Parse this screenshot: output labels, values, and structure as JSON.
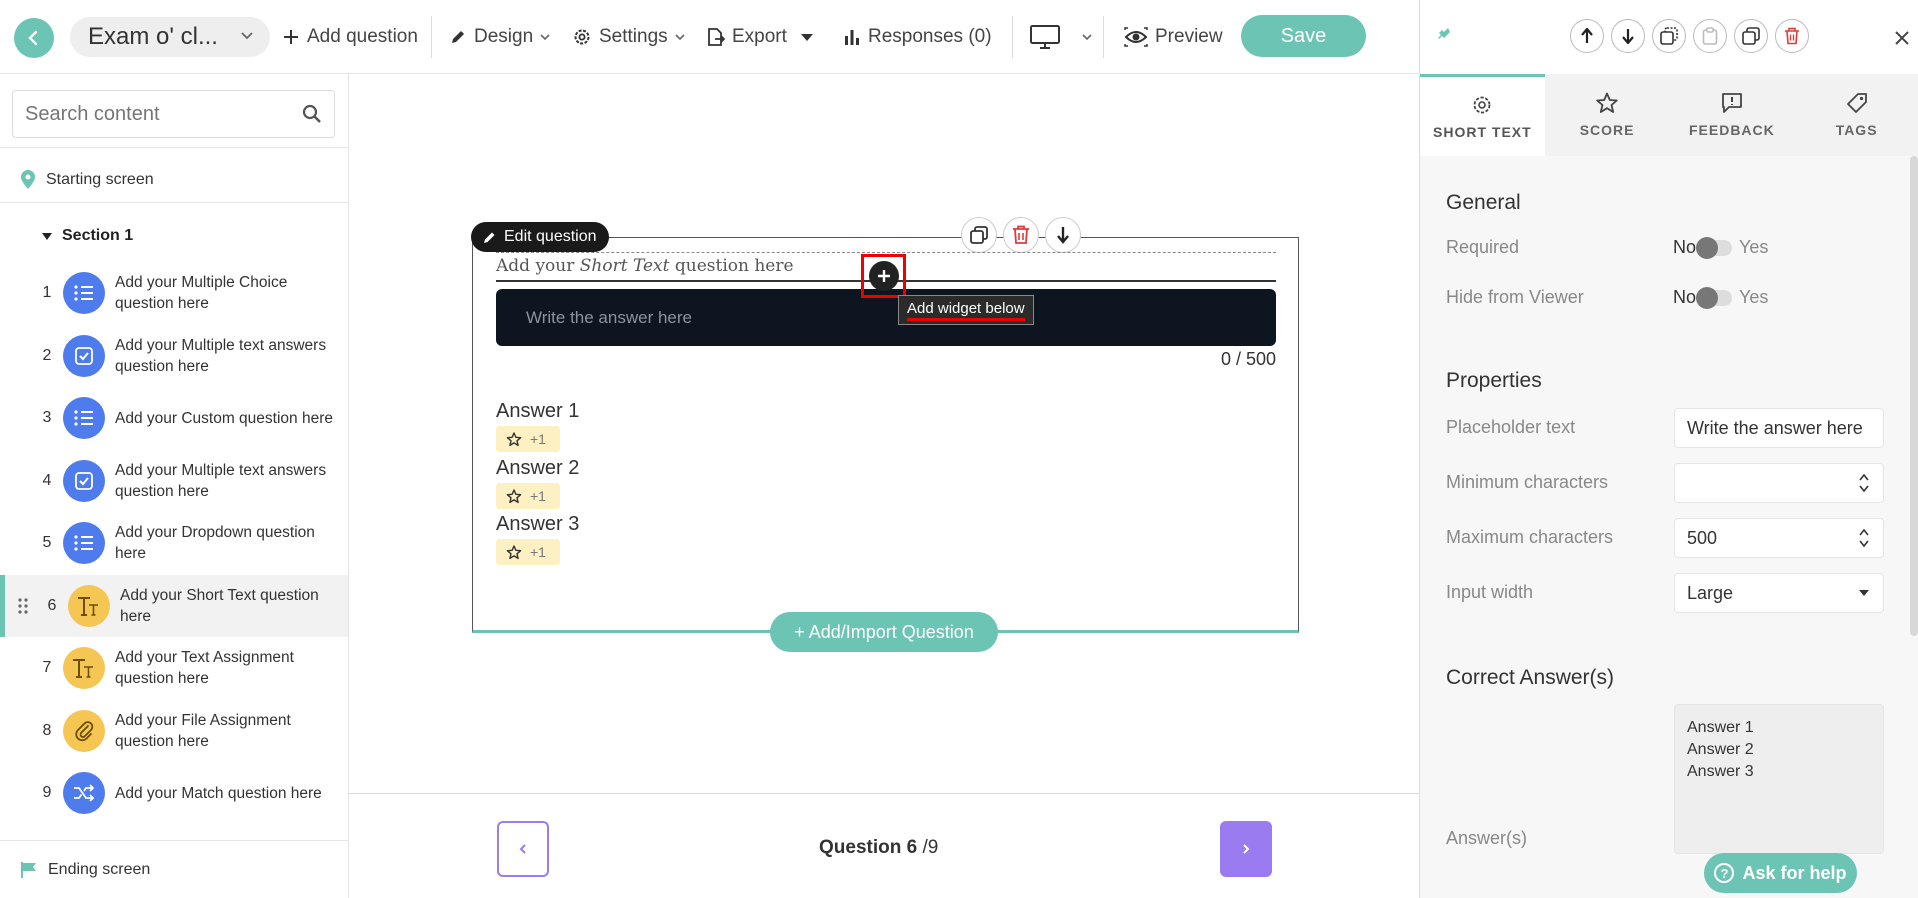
{
  "topbar": {
    "title": "Exam o' cl...",
    "add_question": "Add question",
    "design": "Design",
    "settings": "Settings",
    "export": "Export",
    "responses": "Responses (0)",
    "preview": "Preview",
    "save": "Save"
  },
  "sidebar": {
    "search_placeholder": "Search content",
    "starting_screen": "Starting screen",
    "section": "Section 1",
    "items": [
      {
        "num": "1",
        "label": "Add your Multiple Choice question here",
        "icon": "list-icon",
        "color": "#4f7cec"
      },
      {
        "num": "2",
        "label": "Add your Multiple text answers question here",
        "icon": "checkbox-icon",
        "color": "#4f7cec"
      },
      {
        "num": "3",
        "label": "Add your Custom question here",
        "icon": "list-icon",
        "color": "#4f7cec"
      },
      {
        "num": "4",
        "label": "Add your Multiple text answers question here",
        "icon": "checkbox-icon",
        "color": "#4f7cec"
      },
      {
        "num": "5",
        "label": "Add your Dropdown question here",
        "icon": "list-icon",
        "color": "#4f7cec"
      },
      {
        "num": "6",
        "label": "Add your Short Text question here",
        "icon": "text-icon",
        "color": "#f5c654"
      },
      {
        "num": "7",
        "label": "Add your Text Assignment question here",
        "icon": "text-icon",
        "color": "#f5c654"
      },
      {
        "num": "8",
        "label": "Add your File Assignment question here",
        "icon": "paperclip-icon",
        "color": "#f5c654"
      },
      {
        "num": "9",
        "label": "Add your Match question here",
        "icon": "shuffle-icon",
        "color": "#4f7cec"
      }
    ],
    "ending_screen": "Ending screen"
  },
  "canvas": {
    "edit_question": "Edit question",
    "question_title_prefix": "Add your ",
    "question_title_em": "Short Text",
    "question_title_suffix": " question here",
    "tooltip": "Add widget below",
    "answer_placeholder": "Write the answer here",
    "counter": "0 / 500",
    "answers": [
      {
        "label": "Answer 1",
        "score": "+1"
      },
      {
        "label": "Answer 2",
        "score": "+1"
      },
      {
        "label": "Answer 3",
        "score": "+1"
      }
    ],
    "add_import": "+ Add/Import Question",
    "footer_current": "Question 6",
    "footer_total": " /9"
  },
  "rpanel": {
    "tabs": [
      "SHORT TEXT",
      "SCORE",
      "FEEDBACK",
      "TAGS"
    ],
    "general": "General",
    "required": "Required",
    "hide_from_viewer": "Hide from Viewer",
    "no": "No",
    "yes": "Yes",
    "properties": "Properties",
    "placeholder_text": "Placeholder text",
    "placeholder_value": "Write the answer here",
    "min_chars": "Minimum characters",
    "min_value": "",
    "max_chars": "Maximum characters",
    "max_value": "500",
    "input_width": "Input width",
    "input_width_value": "Large",
    "correct_answers": "Correct Answer(s)",
    "answers_label": "Answer(s)",
    "answers_value": "Answer 1\nAnswer 2\nAnswer 3",
    "help": "Ask for help"
  },
  "colors": {
    "accent": "#6cc4b4",
    "purple": "#9b7bf0",
    "danger": "#e03b3b"
  }
}
